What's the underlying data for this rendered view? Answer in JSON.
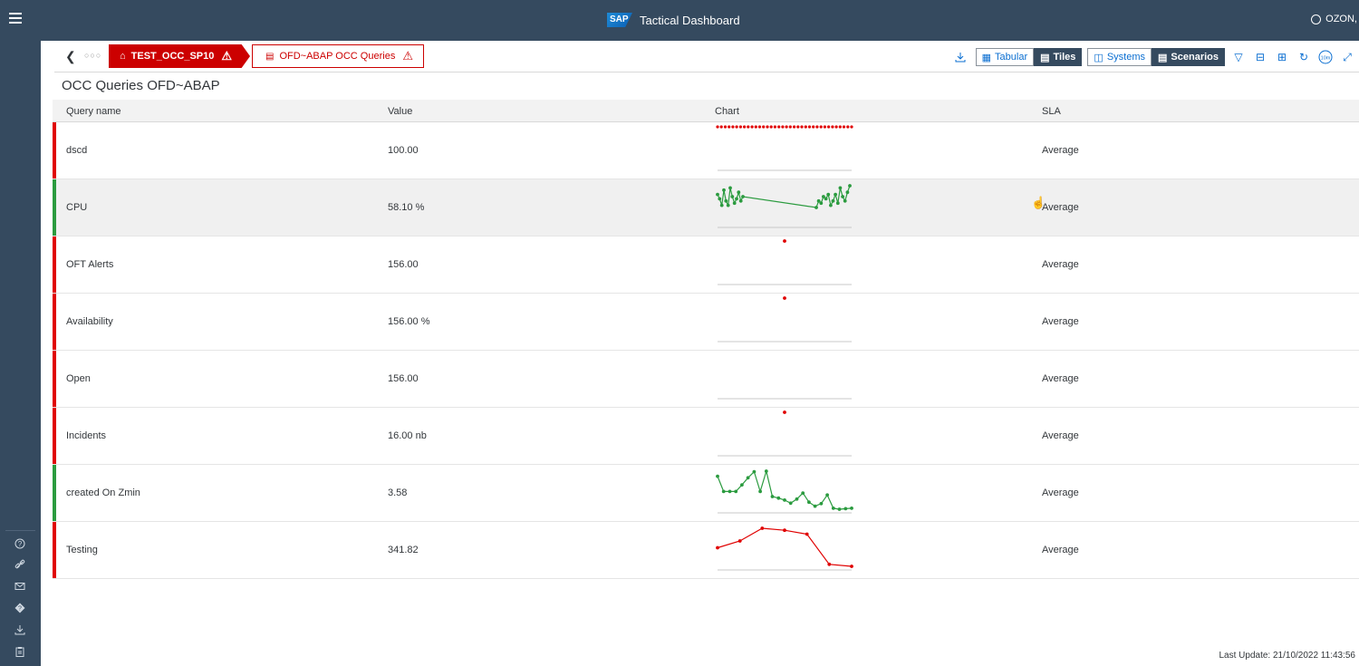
{
  "shell": {
    "title": "Tactical Dashboard",
    "user": "OZON,",
    "logo_text": "SAP"
  },
  "navigation": {
    "crumb1": "TEST_OCC_SP10",
    "crumb2": "OFD~ABAP OCC Queries",
    "toolbar": [
      {
        "label": "Tabular",
        "active": false
      },
      {
        "label": "Tiles",
        "active": true
      },
      {
        "label": "Systems",
        "active": false
      },
      {
        "label": "Scenarios",
        "active": true
      }
    ],
    "timer_label": "10m"
  },
  "page": {
    "title": "OCC Queries OFD~ABAP"
  },
  "table": {
    "columns": [
      "Query name",
      "Value",
      "Chart",
      "SLA"
    ],
    "rows": [
      {
        "name": "dscd",
        "value": "100.00",
        "sla": "Average",
        "status": "#e00000"
      },
      {
        "name": "CPU",
        "value": "58.10 %",
        "sla": "Average",
        "status": "#2b9b3f"
      },
      {
        "name": "OFT Alerts",
        "value": "156.00",
        "sla": "Average",
        "status": "#e00000"
      },
      {
        "name": "Availability",
        "value": "156.00 %",
        "sla": "Average",
        "status": "#e00000"
      },
      {
        "name": "Open",
        "value": "156.00",
        "sla": "Average",
        "status": "#e00000"
      },
      {
        "name": "Incidents",
        "value": "16.00 nb",
        "sla": "Average",
        "status": "#e00000"
      },
      {
        "name": "created On Zmin",
        "value": "3.58",
        "sla": "Average",
        "status": "#2b9b3f"
      },
      {
        "name": "Testing",
        "value": "341.82",
        "sla": "Average",
        "status": "#e00000"
      }
    ]
  },
  "chart_data": [
    {
      "type": "scatter",
      "series": [
        {
          "values": [
            100,
            100,
            100,
            100,
            100,
            100,
            100,
            100,
            100,
            100,
            100,
            100,
            100,
            100,
            100,
            100,
            100,
            100,
            100,
            100,
            100,
            100,
            100,
            100,
            100,
            100,
            100,
            100,
            100,
            100,
            100,
            100,
            100,
            100,
            100,
            100
          ]
        }
      ],
      "color": "#e00000"
    },
    {
      "type": "line",
      "series": [
        {
          "values": [
            60,
            58,
            55,
            62,
            57,
            55,
            63,
            59,
            56,
            58,
            61,
            57,
            59,
            54,
            57,
            56,
            59,
            58,
            60,
            55,
            57,
            60,
            56,
            63,
            59,
            57,
            61,
            64
          ]
        }
      ],
      "color": "#2b9b3f",
      "gap_after_index": 12
    },
    {
      "type": "scatter",
      "series": [
        {
          "values": [
            156
          ]
        }
      ],
      "color": "#e00000"
    },
    {
      "type": "scatter",
      "series": [
        {
          "values": [
            156
          ]
        }
      ],
      "color": "#e00000"
    },
    {
      "type": "empty",
      "series": []
    },
    {
      "type": "scatter",
      "series": [
        {
          "values": [
            16
          ]
        }
      ],
      "color": "#e00000"
    },
    {
      "type": "line",
      "series": [
        {
          "values": [
            9.5,
            6.5,
            6.5,
            6.5,
            7.8,
            9.2,
            10.4,
            6.5,
            10.5,
            5.5,
            5.2,
            4.8,
            4.2,
            5.0,
            6.2,
            4.4,
            3.6,
            4.1,
            5.8,
            3.2,
            3.0,
            3.1,
            3.2
          ]
        }
      ],
      "color": "#2b9b3f"
    },
    {
      "type": "line",
      "series": [
        {
          "values": [
            330,
            337,
            350,
            348,
            344,
            313,
            311
          ]
        }
      ],
      "color": "#e00000"
    }
  ],
  "footer": {
    "last_update": "Last Update: 21/10/2022 11:43:56"
  }
}
